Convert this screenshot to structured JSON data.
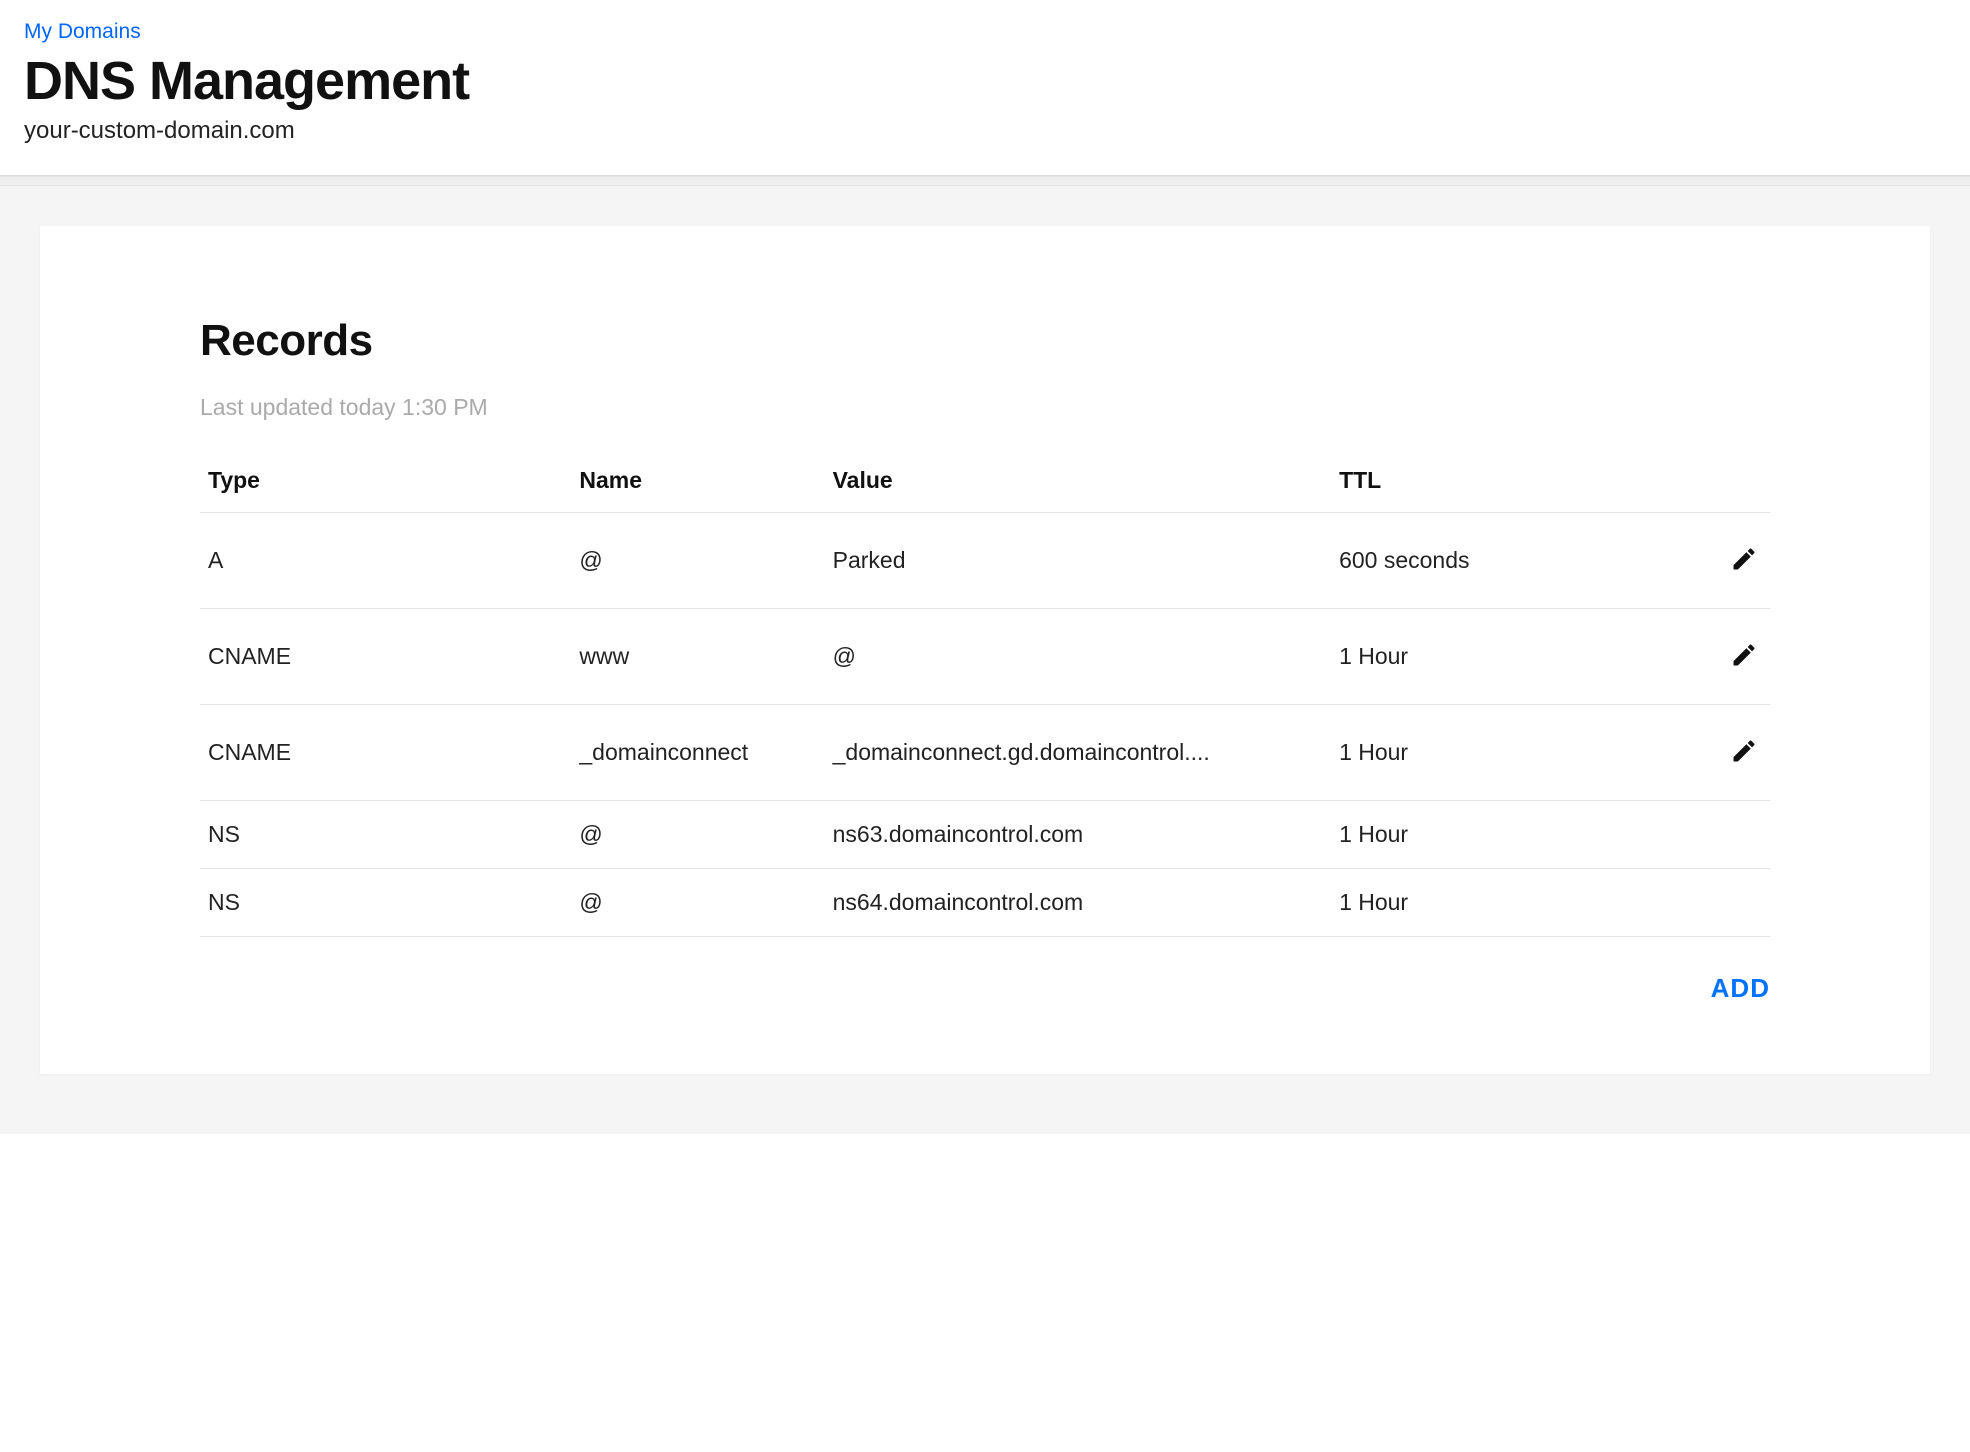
{
  "header": {
    "breadcrumb": "My Domains",
    "title": "DNS Management",
    "domain": "your-custom-domain.com"
  },
  "records": {
    "section_title": "Records",
    "last_updated": "Last updated today 1:30 PM",
    "columns": {
      "type": "Type",
      "name": "Name",
      "value": "Value",
      "ttl": "TTL"
    },
    "rows": [
      {
        "type": "A",
        "name": "@",
        "value": "Parked",
        "ttl": "600 seconds",
        "editable": true
      },
      {
        "type": "CNAME",
        "name": "www",
        "value": "@",
        "ttl": "1 Hour",
        "editable": true
      },
      {
        "type": "CNAME",
        "name": "_domainconnect",
        "value": "_domainconnect.gd.domaincontrol....",
        "ttl": "1 Hour",
        "editable": true
      },
      {
        "type": "NS",
        "name": "@",
        "value": "ns63.domaincontrol.com",
        "ttl": "1 Hour",
        "editable": false
      },
      {
        "type": "NS",
        "name": "@",
        "value": "ns64.domaincontrol.com",
        "ttl": "1 Hour",
        "editable": false
      }
    ],
    "add_label": "ADD"
  }
}
